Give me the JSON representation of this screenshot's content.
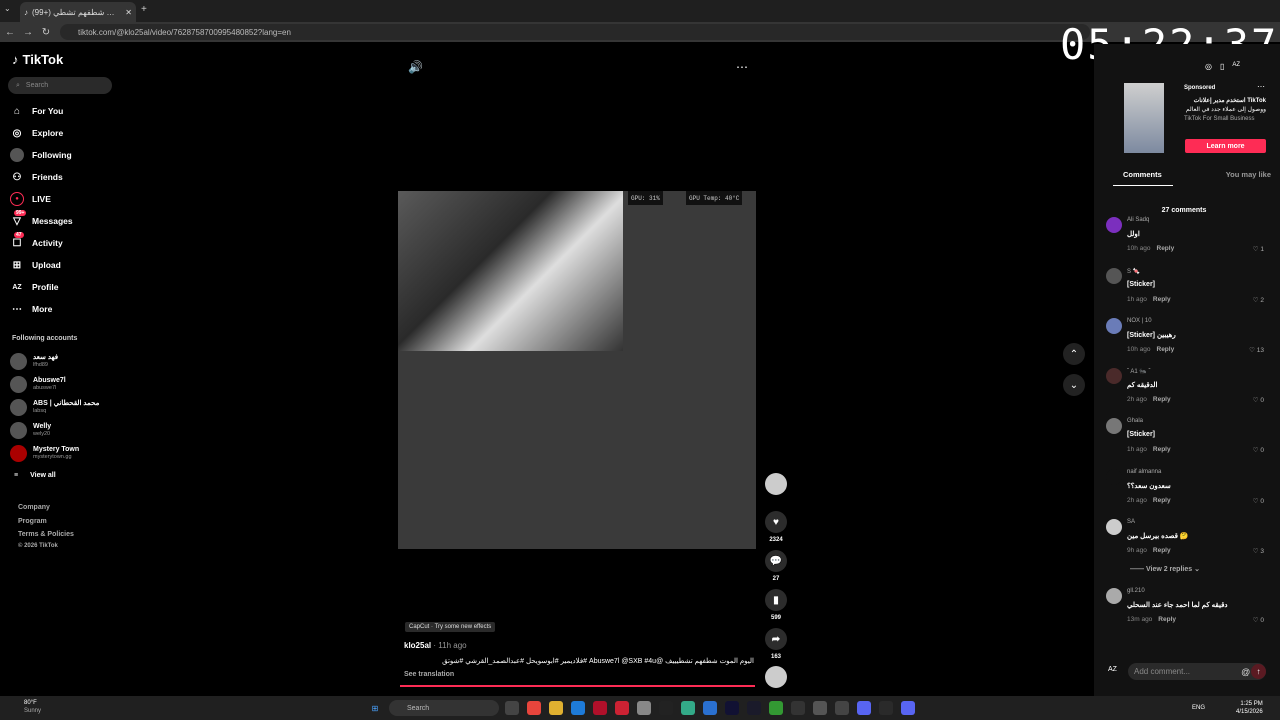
{
  "browser": {
    "tab_title": "(99+) اليوم الموت شطفهم تشطي",
    "url": "tiktok.com/@klo25al/video/7628758700995480852?lang=en",
    "clock": "05:22:37"
  },
  "sidebar": {
    "logo": "TikTok",
    "search_placeholder": "Search",
    "nav": [
      {
        "label": "For You",
        "icon": "home-icon"
      },
      {
        "label": "Explore",
        "icon": "compass-icon"
      },
      {
        "label": "Following",
        "icon": "following-icon"
      },
      {
        "label": "Friends",
        "icon": "friends-icon"
      },
      {
        "label": "LIVE",
        "icon": "live-icon"
      },
      {
        "label": "Messages",
        "icon": "messages-icon",
        "badge": "99+"
      },
      {
        "label": "Activity",
        "icon": "activity-icon",
        "badge": "47"
      },
      {
        "label": "Upload",
        "icon": "upload-icon"
      },
      {
        "label": "Profile",
        "icon": "profile-icon"
      },
      {
        "label": "More",
        "icon": "more-icon"
      }
    ],
    "following_title": "Following accounts",
    "accounts": [
      {
        "name": "فهد سعد",
        "handle": "lfhd89"
      },
      {
        "name": "Abuswe7l",
        "handle": "abuswe7l"
      },
      {
        "name": "ABS | محمد القحطاني",
        "handle": "labsq"
      },
      {
        "name": "Welly",
        "handle": "wely20"
      },
      {
        "name": "Mystery Town",
        "handle": "mysterytown.gg"
      }
    ],
    "view_all": "View all",
    "footer": [
      "Company",
      "Program",
      "Terms & Policies",
      "© 2026 TikTok"
    ]
  },
  "video": {
    "hud_gpu": "GPU: 31%",
    "hud_temp": "GPU Temp: 40°C",
    "effect_tag": "CapCut · Try some new effects",
    "author": "klo25al",
    "time": "· 11h ago",
    "description": "اليوم الموت شطفهم تشطيييف @Abuswe7l @SXB #4u #فلاديمير #ابوسويحل #عبدالصمد_القرشي #شوتق",
    "see_translation": "See translation",
    "likes": "2324",
    "comments": "27",
    "saves": "599",
    "shares": "163"
  },
  "ad": {
    "sponsored": "Sponsored",
    "title": "TikTok استخدم مدير إعلانات",
    "body": "ووصول إلى عملاء جدد في العالم",
    "brand": "TikTok For Small Business",
    "cta": "Learn more"
  },
  "panel": {
    "tab_comments": "Comments",
    "tab_like": "You may like",
    "count": "27 comments",
    "comments": [
      {
        "user": "Ali Sadq",
        "text": "اولل",
        "time": "10h ago",
        "likes": "1"
      },
      {
        "user": "S 🍬",
        "text": "[Sticker]",
        "time": "1h ago",
        "likes": "2"
      },
      {
        "user": "NOX | 10",
        "text": "[Sticker] رهيبين",
        "time": "10h ago",
        "likes": "13"
      },
      {
        "user": "ˇ A1 🐜 ˇ",
        "text": "الدقيقه كم",
        "time": "2h ago",
        "likes": "0"
      },
      {
        "user": "Ghala",
        "text": "[Sticker]",
        "time": "1h ago",
        "likes": "0"
      },
      {
        "user": "naif almanna",
        "text": "سعدون سعد؟؟",
        "time": "2h ago",
        "likes": "0"
      },
      {
        "user": "SA",
        "text": "قصده بيرسل مين 🤔",
        "time": "9h ago",
        "likes": "3"
      },
      {
        "user": "gll.210",
        "text": "دقيقه كم لما احمد جاء عند السحلي",
        "time": "13m ago",
        "likes": "0"
      }
    ],
    "reply_label": "Reply",
    "view_replies": "View 2 replies",
    "add_comment": "Add comment..."
  },
  "taskbar": {
    "weather_temp": "80°F",
    "weather_desc": "Sunny",
    "search": "Search",
    "lang": "ENG",
    "time": "1:25 PM",
    "date": "4/15/2026"
  }
}
